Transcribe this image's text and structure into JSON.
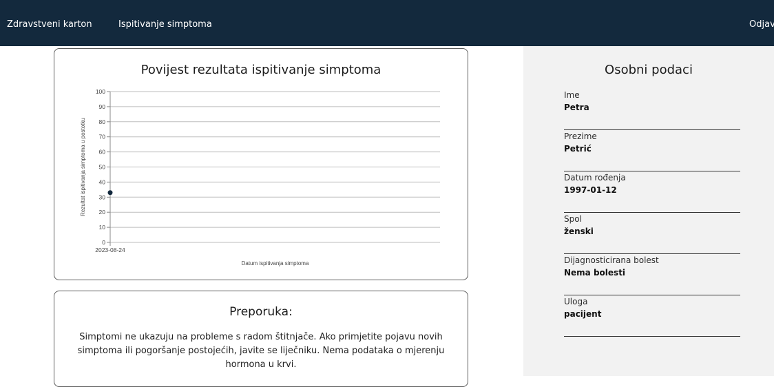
{
  "nav": {
    "brand": "Zdravstveni karton",
    "symptoms": "Ispitivanje simptoma",
    "logout": "Odjava"
  },
  "chart_card": {
    "title": "Povijest rezultata ispitivanje simptoma"
  },
  "chart_data": {
    "type": "line",
    "title": "Povijest rezultata ispitivanje simptoma",
    "xlabel": "Datum ispitivanja simptoma",
    "ylabel": "Rezultat ispitivanja simptoma u postotku",
    "x": [
      "2023-08-24"
    ],
    "series": [
      {
        "values": [
          33
        ]
      }
    ],
    "ylim": [
      0,
      100
    ],
    "yticks": [
      0,
      10,
      20,
      30,
      40,
      50,
      60,
      70,
      80,
      90,
      100
    ],
    "grid": true,
    "point_color": "#13293d"
  },
  "recommendation": {
    "title": "Preporuka:",
    "text": "Simptomi ne ukazuju na probleme s radom štitnjače. Ako primjetite pojavu novih simptoma ili pogoršanje postojećih, javite se liječniku. Nema podataka o mjerenju hormona u krvi."
  },
  "personal": {
    "title": "Osobni podaci",
    "fields": [
      {
        "label": "Ime",
        "value": "Petra"
      },
      {
        "label": "Prezime",
        "value": "Petrić"
      },
      {
        "label": "Datum rođenja",
        "value": "1997-01-12"
      },
      {
        "label": "Spol",
        "value": "ženski"
      },
      {
        "label": "Dijagnosticirana bolest",
        "value": "Nema bolesti"
      },
      {
        "label": "Uloga",
        "value": "pacijent"
      }
    ]
  },
  "colors": {
    "navbar": "#13293d",
    "sidebar": "#f2f2f2"
  }
}
